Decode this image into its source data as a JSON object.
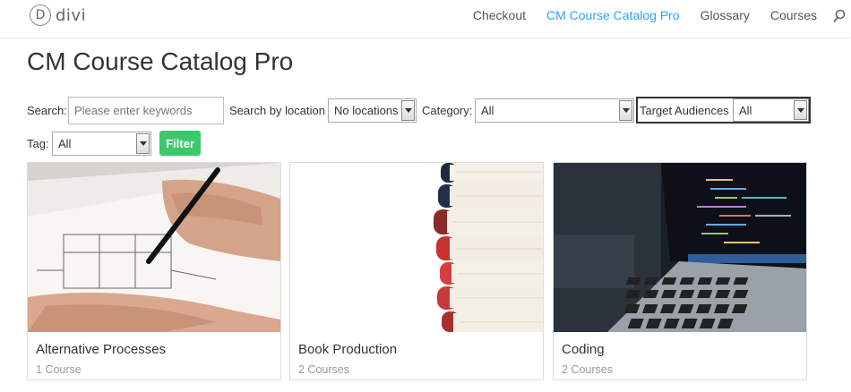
{
  "header": {
    "logo_letter": "D",
    "logo_text": "divi",
    "nav": [
      {
        "label": "Checkout",
        "active": false
      },
      {
        "label": "CM Course Catalog Pro",
        "active": true
      },
      {
        "label": "Glossary",
        "active": false
      },
      {
        "label": "Courses",
        "active": false
      }
    ],
    "search_icon": "search-icon",
    "accent_color": "#2ea3f2"
  },
  "page": {
    "title": "CM Course Catalog Pro"
  },
  "filters": {
    "search_label": "Search:",
    "search_placeholder": "Please enter keywords",
    "location_label": "Search by location",
    "location_value": "No locations",
    "category_label": "Category:",
    "category_value": "All",
    "audience_label": "Target Audiences",
    "audience_value": "All",
    "tag_label": "Tag:",
    "tag_value": "All",
    "filter_button": "Filter",
    "filter_button_color": "#3cc86c"
  },
  "courses": [
    {
      "title": "Alternative Processes",
      "count": "1 Course",
      "image": "drawing-blueprint"
    },
    {
      "title": "Book Production",
      "count": "2 Courses",
      "image": "stack-of-books"
    },
    {
      "title": "Coding",
      "count": "2 Courses",
      "image": "laptop-code"
    }
  ]
}
